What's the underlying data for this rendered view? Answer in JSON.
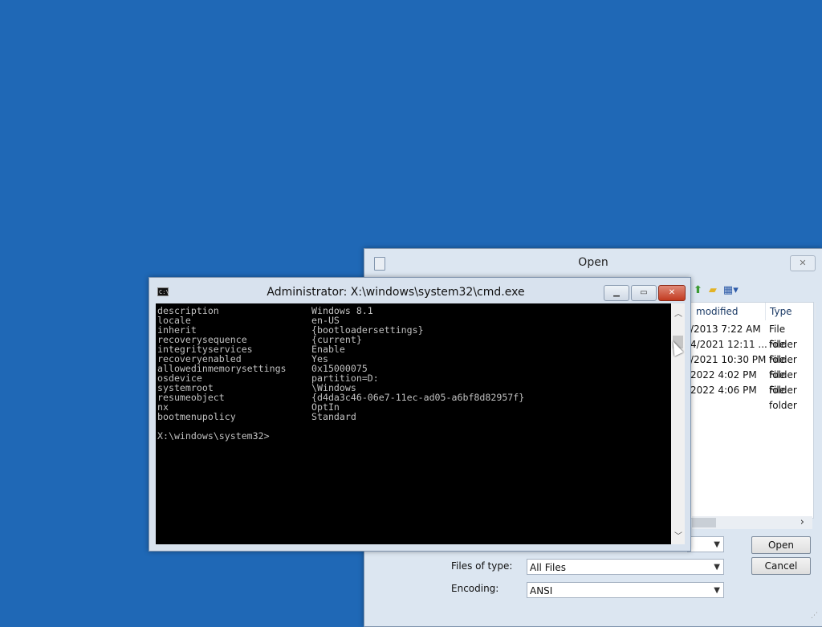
{
  "open_dialog": {
    "title": "Open",
    "columns": {
      "modified": "modified",
      "type": "Type"
    },
    "rows": [
      {
        "modified": "/2013 7:22 AM",
        "type": "File folder"
      },
      {
        "modified": "4/2021 12:11 ...",
        "type": "File folder"
      },
      {
        "modified": "/2021 10:30 PM",
        "type": "File folder"
      },
      {
        "modified": "2022 4:02 PM",
        "type": "File folder"
      },
      {
        "modified": "2022 4:06 PM",
        "type": "File folder"
      }
    ],
    "files_of_type_label": "Files of type:",
    "files_of_type_value": "All Files",
    "encoding_label": "Encoding:",
    "encoding_value": "ANSI",
    "open_button": "Open",
    "cancel_button": "Cancel",
    "icons": [
      "up-folder-icon",
      "new-folder-icon",
      "view-menu-icon"
    ]
  },
  "cmd": {
    "title": "Administrator: X:\\windows\\system32\\cmd.exe",
    "lines": [
      {
        "key": "description",
        "value": "Windows 8.1"
      },
      {
        "key": "locale",
        "value": "en-US"
      },
      {
        "key": "inherit",
        "value": "{bootloadersettings}"
      },
      {
        "key": "recoverysequence",
        "value": "{current}"
      },
      {
        "key": "integrityservices",
        "value": "Enable"
      },
      {
        "key": "recoveryenabled",
        "value": "Yes"
      },
      {
        "key": "allowedinmemorysettings",
        "value": "0x15000075"
      },
      {
        "key": "osdevice",
        "value": "partition=D:"
      },
      {
        "key": "systemroot",
        "value": "\\Windows"
      },
      {
        "key": "resumeobject",
        "value": "{d4da3c46-06e7-11ec-ad05-a6bf8d82957f}"
      },
      {
        "key": "nx",
        "value": "OptIn"
      },
      {
        "key": "bootmenupolicy",
        "value": "Standard"
      }
    ],
    "prompt": "X:\\windows\\system32>"
  },
  "colors": {
    "desktop": "#1f68b6",
    "console_bg": "#000000",
    "console_text": "#c0c0c0",
    "close_button": "#c23b21"
  }
}
